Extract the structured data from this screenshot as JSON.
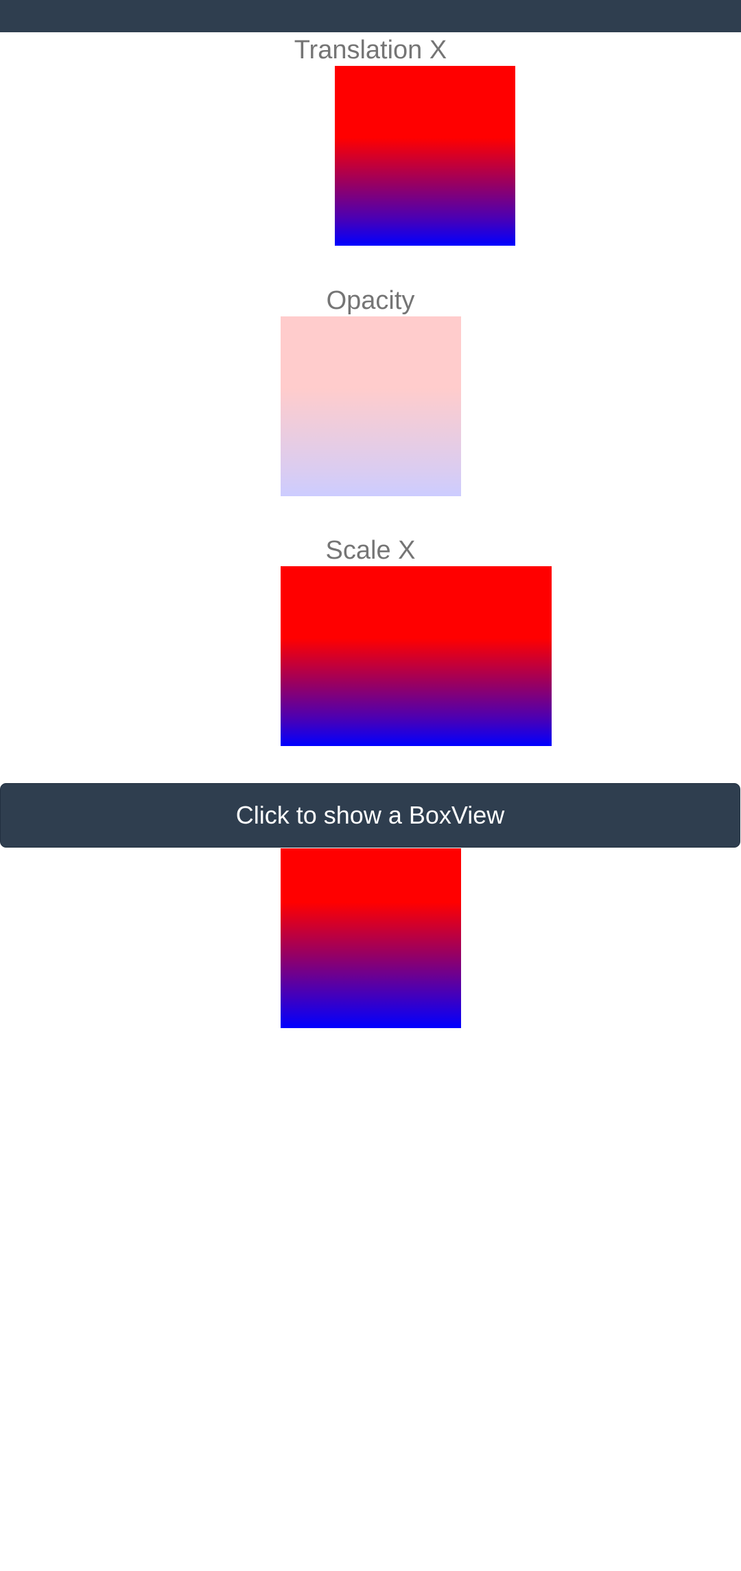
{
  "app": {
    "header_color": "#2f3e4f"
  },
  "sections": {
    "translation": {
      "label": "Translation X"
    },
    "opacity": {
      "label": "Opacity",
      "opacity_value": 0.2
    },
    "scale": {
      "label": "Scale X"
    }
  },
  "button": {
    "label": "Click to show a BoxView",
    "color": "#2f3e4f"
  },
  "gradient": {
    "start_color": "#ff0000",
    "end_color": "#0000ff"
  }
}
